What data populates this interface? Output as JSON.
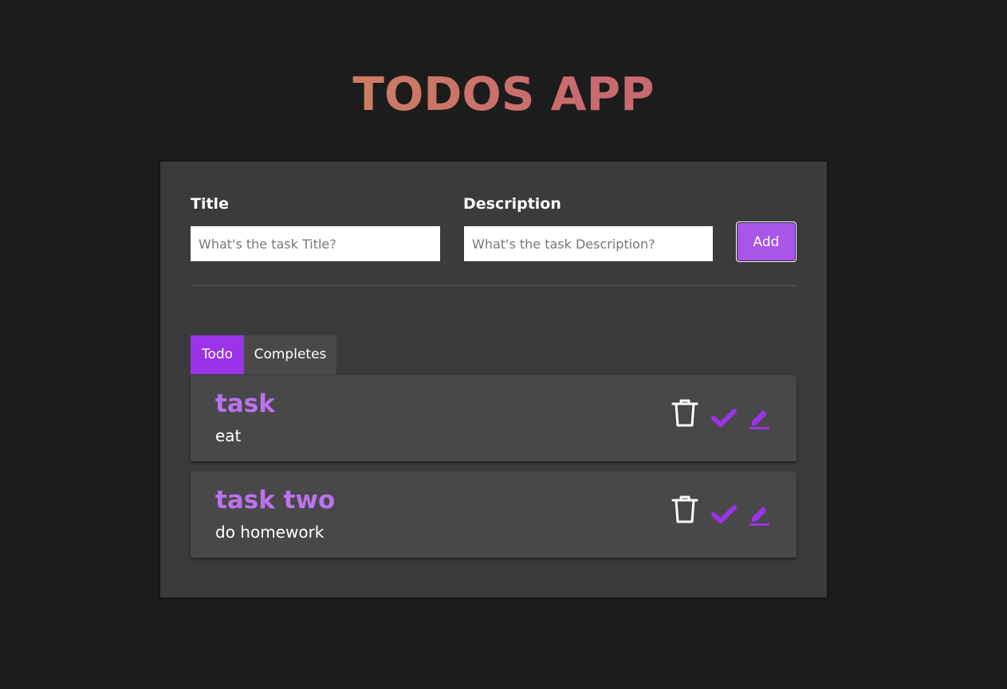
{
  "app": {
    "title": "TODOS APP"
  },
  "form": {
    "title_label": "Title",
    "title_placeholder": "What's the task Title?",
    "description_label": "Description",
    "description_placeholder": "What's the task Description?",
    "add_label": "Add"
  },
  "tabs": [
    {
      "label": "Todo",
      "active": true
    },
    {
      "label": "Completes",
      "active": false
    }
  ],
  "tasks": [
    {
      "title": "task",
      "description": "eat"
    },
    {
      "title": "task two",
      "description": "do homework"
    }
  ],
  "task_actions": [
    "trash-icon",
    "check-icon",
    "edit-icon"
  ],
  "colors": {
    "background": "#1c1c1c",
    "panel": "#3c3b3c",
    "accent": "#9b33e8",
    "task_title": "#bb72ef",
    "title_gradient": [
      "#d39a4e",
      "#c45f80"
    ]
  }
}
